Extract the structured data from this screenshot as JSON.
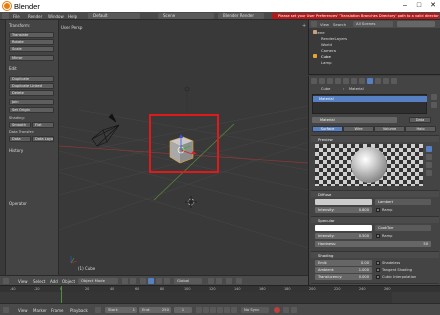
{
  "window": {
    "title": "Blender"
  },
  "info_header": {
    "editor_menus": [
      "File",
      "Render",
      "Window",
      "Help"
    ],
    "layout": "Default",
    "scene": "Scene",
    "render_engine": "Blender Render",
    "warning": "Please set your User Preferences' 'Translation Branches Directory' path to a valid directory"
  },
  "tool_shelf": {
    "transform_header": "Transform:",
    "transform_buttons": [
      "Translate",
      "Rotate",
      "Scale",
      "Mirror"
    ],
    "edit_header": "Edit",
    "edit_buttons": [
      "Duplicate",
      "Duplicate Linked",
      "Delete",
      "Join"
    ],
    "set_origin": "Set Origin",
    "shading_label": "Shading:",
    "smooth": "Smooth",
    "flat": "Flat",
    "data_transfer_label": "Data Transfer:",
    "data": "Data",
    "data_layout": "Data Layo",
    "history": "History",
    "operator": "Operator"
  },
  "viewport": {
    "view_label": "User Persp",
    "object_label": "(1) Cube",
    "highlight_color": "#e0191b"
  },
  "view3d_header": {
    "menus": [
      "View",
      "Select",
      "Add",
      "Object"
    ],
    "mode": "Object Mode",
    "orientation": "Global"
  },
  "outliner": {
    "view": "View",
    "search": "Search",
    "filter": "All Scenes",
    "items": [
      "Scene",
      "RenderLayers",
      "World",
      "Camera",
      "Cube",
      "Lamp"
    ]
  },
  "properties": {
    "breadcrumb": [
      "Cube",
      "Material"
    ],
    "material_slot": "Material",
    "material_name": "Material",
    "data_button": "Data",
    "tabs": [
      "Surface",
      "Wire",
      "Volume",
      "Halo"
    ],
    "preview_header": "Preview",
    "diffuse_header": "Diffuse",
    "diffuse_shader": "Lambert",
    "diffuse_intensity_label": "Intensity:",
    "diffuse_intensity": "0.800",
    "ramp": "Ramp",
    "specular_header": "Specular",
    "specular_shader": "CookTorr",
    "specular_intensity_label": "Intensity:",
    "specular_intensity": "0.500",
    "hardness_label": "Hardness:",
    "hardness": "50",
    "shading_header": "Shading",
    "emit_label": "Emit:",
    "emit": "0.00",
    "ambient_label": "Ambient:",
    "ambient": "1.000",
    "translucency_label": "Translucency:",
    "translucency": "0.000",
    "shadeless": "Shadeless",
    "tangent_shading": "Tangent Shading",
    "cubic_interpolation": "Cubic Interpolation",
    "transparency_header": "Transparency",
    "bottom_buttons": [
      "Mask",
      "Z Transparency",
      "Raytrace"
    ],
    "accent": "#5680c2"
  },
  "timeline": {
    "ticks": [
      "-40",
      "-20",
      "0",
      "20",
      "40",
      "60",
      "80",
      "100",
      "120",
      "140",
      "160",
      "180",
      "200",
      "220",
      "240",
      "260"
    ],
    "menus": [
      "View",
      "Marker",
      "Frame",
      "Playback"
    ],
    "start_label": "Start:",
    "start": "1",
    "end_label": "End:",
    "end": "250",
    "current": "1",
    "sync": "No Sync"
  }
}
